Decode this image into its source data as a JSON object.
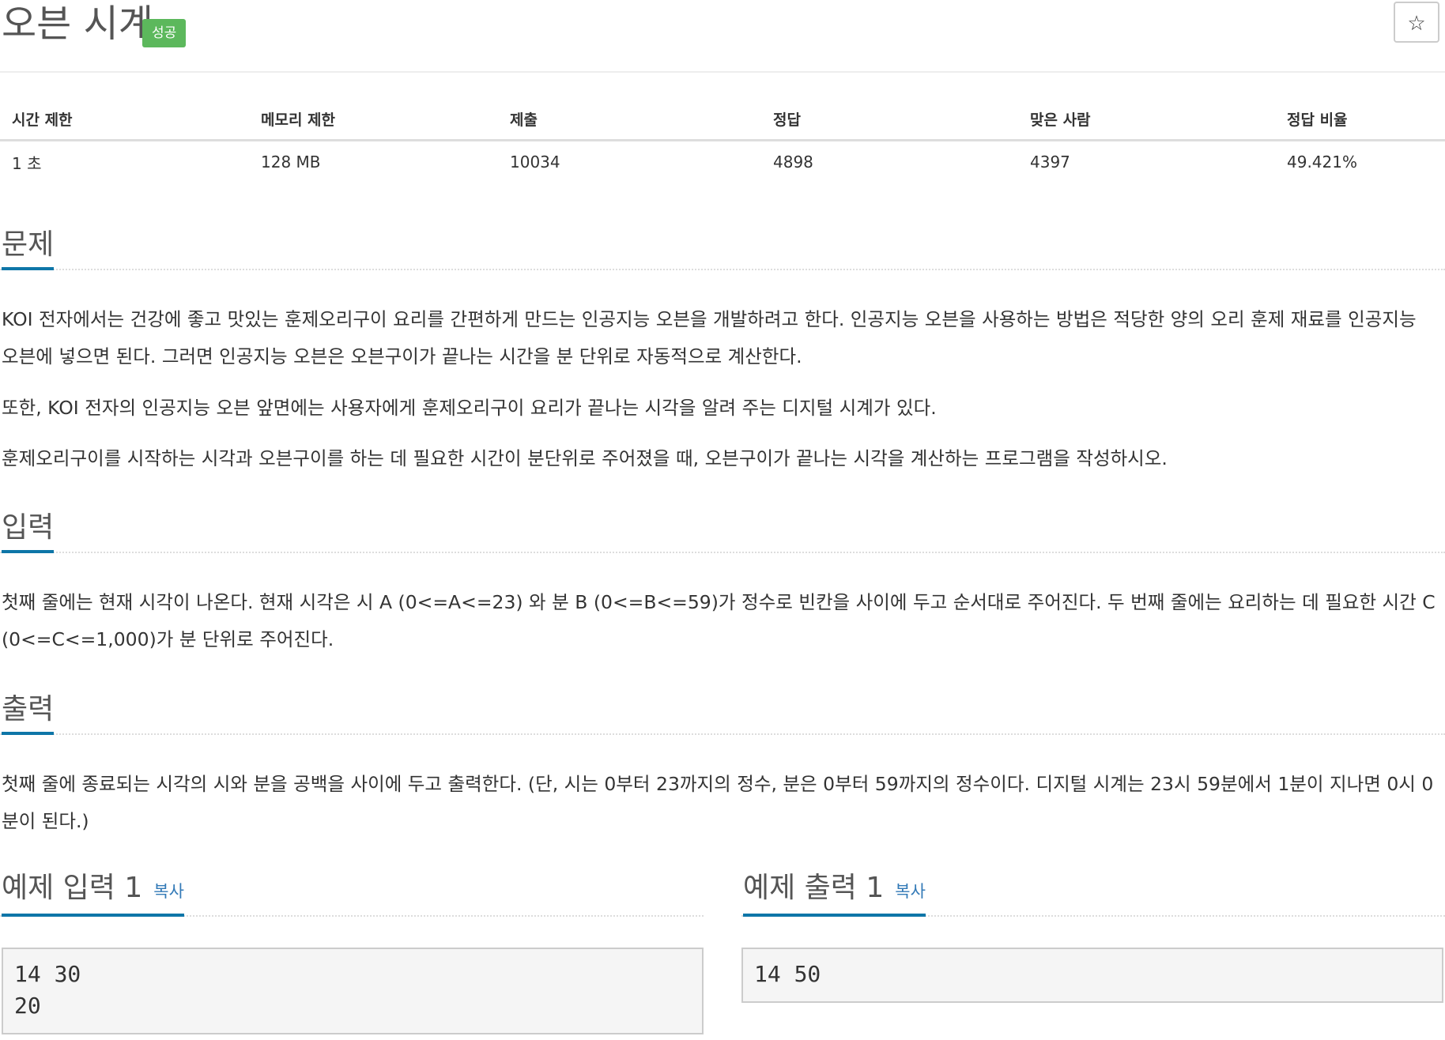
{
  "problem": {
    "title": "오븐 시계",
    "badge": "성공",
    "star_glyph": "☆"
  },
  "info_table": {
    "headers": [
      "시간 제한",
      "메모리 제한",
      "제출",
      "정답",
      "맞은 사람",
      "정답 비율"
    ],
    "values": [
      "1 초",
      "128 MB",
      "10034",
      "4898",
      "4397",
      "49.421%"
    ]
  },
  "sections": {
    "description": {
      "heading": "문제",
      "paragraphs": [
        "KOI 전자에서는 건강에 좋고 맛있는 훈제오리구이 요리를 간편하게 만드는 인공지능 오븐을 개발하려고 한다. 인공지능 오븐을 사용하는 방법은 적당한 양의 오리 훈제 재료를 인공지능",
        "오븐에 넣으면 된다. 그러면 인공지능 오븐은  오븐구이가 끝나는 시간을 분 단위로 자동적으로 계산한다.",
        "또한, KOI 전자의 인공지능 오븐 앞면에는 사용자에게 훈제오리구이 요리가 끝나는 시각을 알려 주는 디지털 시계가 있다.",
        "훈제오리구이를 시작하는 시각과 오븐구이를 하는 데 필요한 시간이 분단위로 주어졌을 때, 오븐구이가 끝나는 시각을 계산하는 프로그램을 작성하시오."
      ]
    },
    "input": {
      "heading": "입력",
      "paragraphs": [
        "첫째 줄에는 현재 시각이 나온다. 현재 시각은 시 A (0<=A<=23) 와 분 B (0<=B<=59)가 정수로 빈칸을 사이에 두고 순서대로 주어진다. 두 번째 줄에는 요리하는 데 필요한 시간 C",
        " (0<=C<=1,000)가 분 단위로 주어진다."
      ]
    },
    "output": {
      "heading": "출력",
      "paragraphs": [
        "첫째 줄에 종료되는 시각의 시와 분을 공백을 사이에 두고 출력한다. (단, 시는 0부터 23까지의 정수, 분은 0부터 59까지의 정수이다. 디지털 시계는 23시 59분에서 1분이 지나면 0시 0",
        "분이 된다.)"
      ]
    }
  },
  "samples": {
    "input_heading": "예제 입력 1",
    "output_heading": "예제 출력 1",
    "copy_label": "복사",
    "input_text": "14 30\n20",
    "output_text": "14 50"
  }
}
